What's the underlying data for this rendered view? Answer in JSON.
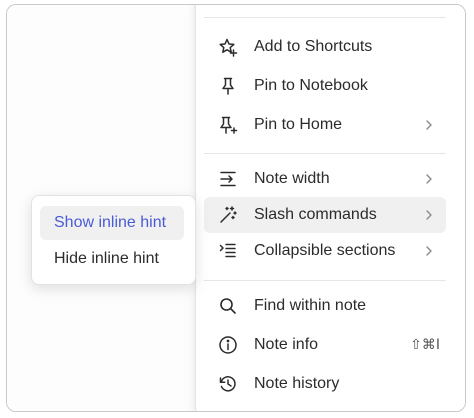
{
  "menu": {
    "items": [
      {
        "label": "Add to Shortcuts",
        "icon": "star-plus-icon"
      },
      {
        "label": "Pin to Notebook",
        "icon": "pin-icon"
      },
      {
        "label": "Pin to Home",
        "icon": "pin-plus-icon"
      },
      {
        "label": "Note width",
        "icon": "width-icon"
      },
      {
        "label": "Slash commands",
        "icon": "magic-wand-icon"
      },
      {
        "label": "Collapsible sections",
        "icon": "collapsible-list-icon"
      },
      {
        "label": "Find within note",
        "icon": "search-icon"
      },
      {
        "label": "Note info",
        "icon": "info-icon",
        "shortcut": "⇧⌘I"
      },
      {
        "label": "Note history",
        "icon": "history-icon"
      }
    ]
  },
  "submenu": {
    "items": [
      {
        "label": "Show inline hint"
      },
      {
        "label": "Hide inline hint"
      }
    ]
  },
  "colors": {
    "accent": "#4a5bd6",
    "active_background": "#f0f0f0",
    "text": "#2b2b2b"
  }
}
